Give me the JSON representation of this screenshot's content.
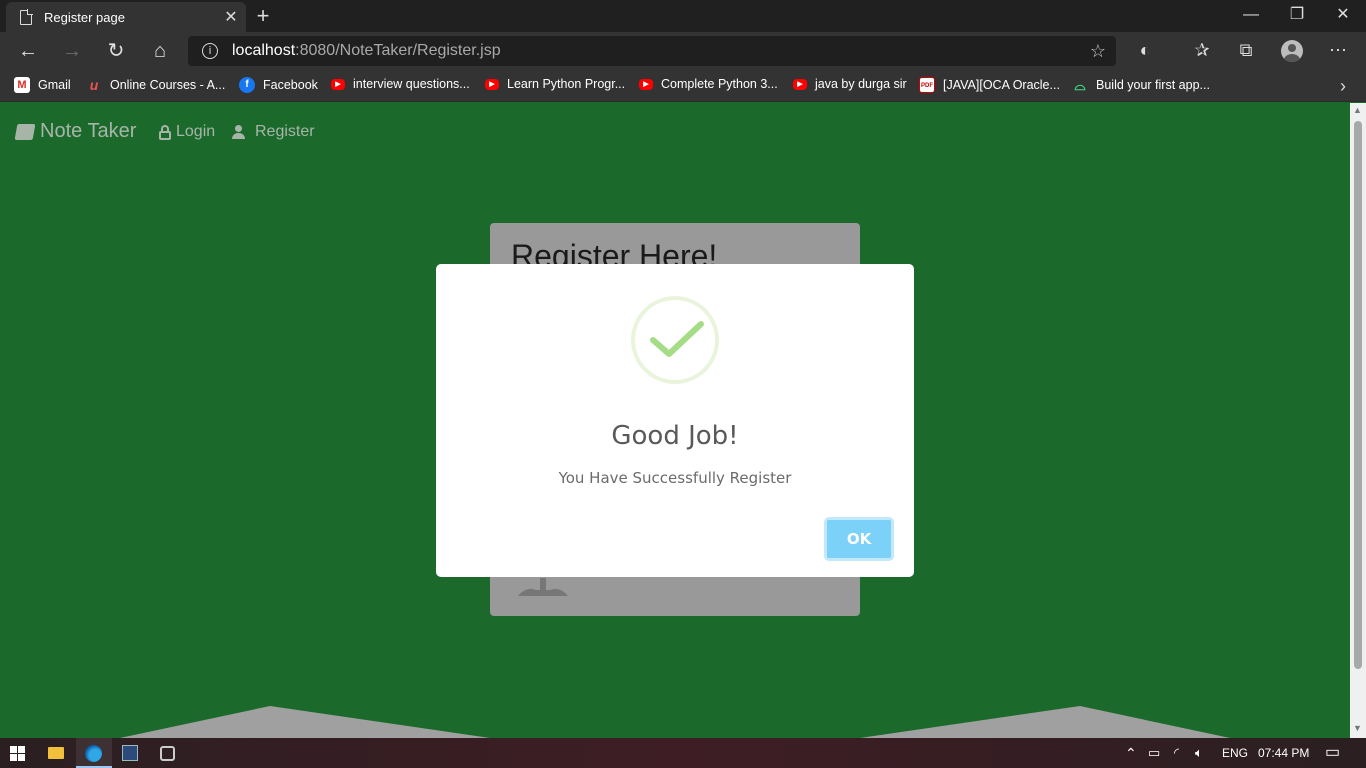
{
  "browser": {
    "tab_title": "Register page",
    "tab_close": "✕",
    "new_tab": "+",
    "url_host": "localhost",
    "url_path": ":8080/NoteTaker/Register.jsp",
    "window_controls": [
      "—",
      "❐",
      "✕"
    ]
  },
  "bookmarks": [
    {
      "label": "Gmail",
      "icon": "gmail-icon"
    },
    {
      "label": "Online Courses - A...",
      "icon": "udemy-icon"
    },
    {
      "label": "Facebook",
      "icon": "facebook-icon"
    },
    {
      "label": "interview questions...",
      "icon": "youtube-icon"
    },
    {
      "label": "Learn Python Progr...",
      "icon": "youtube-icon"
    },
    {
      "label": "Complete Python 3...",
      "icon": "youtube-icon"
    },
    {
      "label": "java by durga sir",
      "icon": "youtube-icon"
    },
    {
      "label": "[JAVA][OCA Oracle...",
      "icon": "pdf-icon"
    },
    {
      "label": "Build your first app...",
      "icon": "android-icon"
    }
  ],
  "site": {
    "brand": "Note Taker",
    "nav_login": "Login",
    "nav_register": "Register",
    "card_title": "Register Here!"
  },
  "modal": {
    "title": "Good Job!",
    "message": "You Have Successfully Register",
    "ok_label": "OK"
  },
  "taskbar": {
    "language": "ENG",
    "time": "07:44 PM"
  },
  "colors": {
    "page_background": "#1b6a2b",
    "ok_button": "#7cd1f9",
    "success_check": "#a5dc86"
  }
}
